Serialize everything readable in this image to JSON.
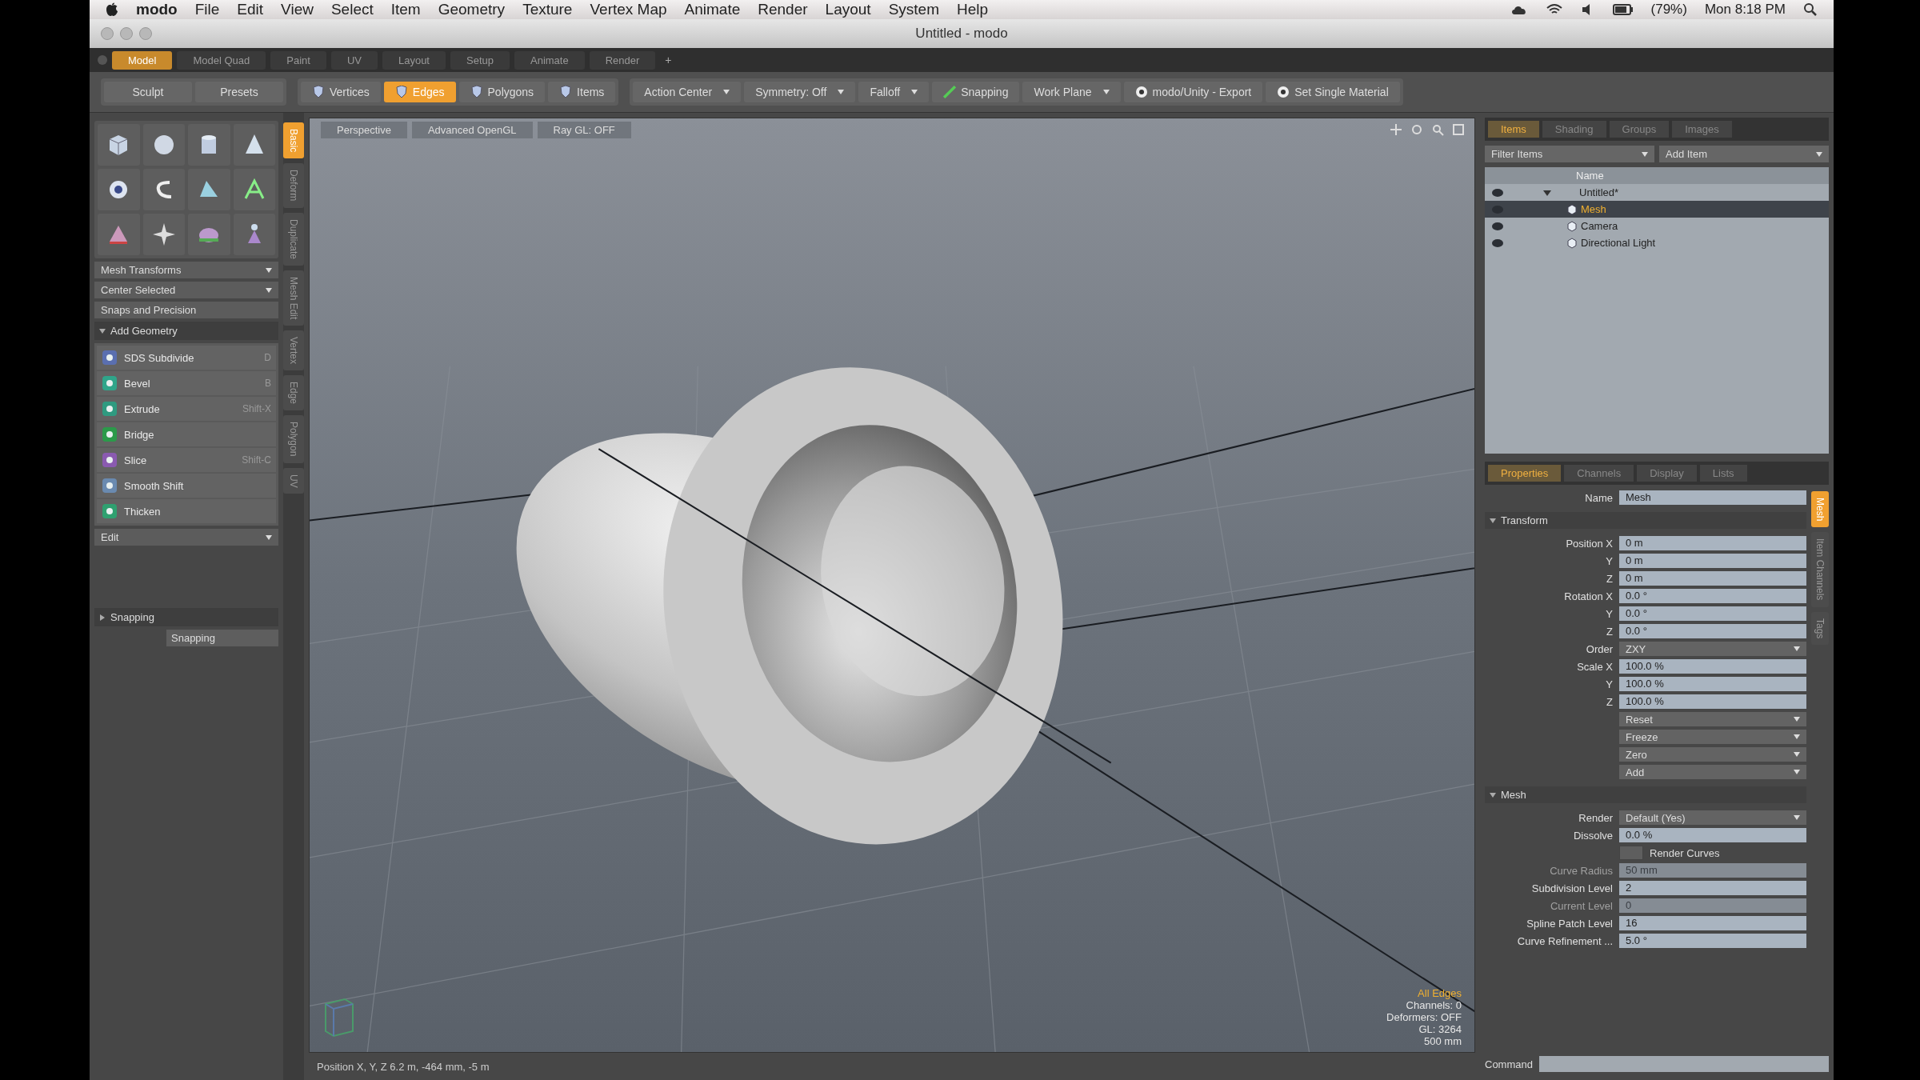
{
  "menubar": {
    "app": "modo",
    "items": [
      "File",
      "Edit",
      "View",
      "Select",
      "Item",
      "Geometry",
      "Texture",
      "Vertex Map",
      "Animate",
      "Render",
      "Layout",
      "System",
      "Help"
    ],
    "battery": "(79%)",
    "clock": "Mon 8:18 PM"
  },
  "window": {
    "title": "Untitled - modo"
  },
  "layout_tabs": [
    {
      "label": "Model",
      "selected": true
    },
    {
      "label": "Model Quad",
      "selected": false
    },
    {
      "label": "Paint",
      "selected": false
    },
    {
      "label": "UV",
      "selected": false
    },
    {
      "label": "Layout",
      "selected": false
    },
    {
      "label": "Setup",
      "selected": false
    },
    {
      "label": "Animate",
      "selected": false
    },
    {
      "label": "Render",
      "selected": false
    }
  ],
  "add_tab": "+",
  "toolbar": {
    "left_buttons": [
      "Sculpt",
      "Presets"
    ],
    "modes": [
      {
        "label": "Vertices",
        "selected": false
      },
      {
        "label": "Edges",
        "selected": true
      },
      {
        "label": "Polygons",
        "selected": false
      },
      {
        "label": "Items",
        "selected": false
      }
    ],
    "dropdowns": [
      "Action Center",
      "Symmetry: Off",
      "Falloff"
    ],
    "snapping": "Snapping",
    "work_plane": "Work Plane",
    "actions": [
      "modo/Unity - Export",
      "Set Single Material"
    ]
  },
  "toolbox": {
    "dropdowns": [
      "Mesh Transforms",
      "Center Selected"
    ],
    "snaps": "Snaps and Precision",
    "section": "Add Geometry",
    "tools": [
      {
        "label": "SDS Subdivide",
        "shortcut": "D"
      },
      {
        "label": "Bevel",
        "shortcut": "B"
      },
      {
        "label": "Extrude",
        "shortcut": "Shift-X"
      },
      {
        "label": "Bridge"
      },
      {
        "label": "Slice",
        "shortcut": "Shift-C"
      },
      {
        "label": "Smooth Shift"
      },
      {
        "label": "Thicken"
      }
    ],
    "edit": "Edit",
    "snapping_section": "Snapping",
    "snapping_button": "Snapping"
  },
  "side_tabs": [
    {
      "label": "Basic",
      "selected": true
    },
    {
      "label": "Deform",
      "selected": false
    },
    {
      "label": "Duplicate",
      "selected": false
    },
    {
      "label": "Mesh Edit",
      "selected": false
    },
    {
      "label": "Vertex",
      "selected": false
    },
    {
      "label": "Edge",
      "selected": false
    },
    {
      "label": "Polygon",
      "selected": false
    },
    {
      "label": "UV",
      "selected": false
    }
  ],
  "viewport": {
    "tabs": [
      "Perspective",
      "Advanced OpenGL",
      "Ray GL: OFF"
    ],
    "info": [
      "All Edges",
      "Channels: 0",
      "Deformers: OFF",
      "GL: 3264",
      "500 mm"
    ],
    "status": "Position X, Y, Z   6.2 m, -464 mm, -5 m"
  },
  "outliner": {
    "tabs": [
      {
        "label": "Items",
        "selected": true
      },
      {
        "label": "Shading",
        "selected": false
      },
      {
        "label": "Groups",
        "selected": false
      },
      {
        "label": "Images",
        "selected": false
      }
    ],
    "filter": "Filter Items",
    "add": "Add Item",
    "header": "Name",
    "tree": [
      {
        "label": "Untitled*",
        "expanded": true,
        "selected": false,
        "children": [
          {
            "label": "Mesh",
            "selected": true
          },
          {
            "label": "Camera",
            "selected": false
          },
          {
            "label": "Directional Light",
            "selected": false
          }
        ]
      }
    ]
  },
  "properties": {
    "tabs": [
      {
        "label": "Properties",
        "selected": true
      },
      {
        "label": "Channels",
        "selected": false
      },
      {
        "label": "Display",
        "selected": false
      },
      {
        "label": "Lists",
        "selected": false
      }
    ],
    "side_tabs": [
      {
        "label": "Mesh",
        "selected": true
      },
      {
        "label": "Item Channels",
        "selected": false
      },
      {
        "label": "Tags",
        "selected": false
      }
    ],
    "rows": [
      {
        "kind": "field",
        "label": "Name",
        "value": "Mesh",
        "disabled": false
      },
      {
        "kind": "section",
        "label": "Transform"
      },
      {
        "kind": "field",
        "label": "Position X",
        "value": "0 m",
        "disabled": false
      },
      {
        "kind": "field",
        "label": "Y",
        "value": "0 m",
        "disabled": false
      },
      {
        "kind": "field",
        "label": "Z",
        "value": "0 m",
        "disabled": false
      },
      {
        "kind": "field",
        "label": "Rotation X",
        "value": "0.0 °",
        "disabled": false
      },
      {
        "kind": "field",
        "label": "Y",
        "value": "0.0 °",
        "disabled": false
      },
      {
        "kind": "field",
        "label": "Z",
        "value": "0.0 °",
        "disabled": false
      },
      {
        "kind": "dropdown",
        "label": "Order",
        "value": "ZXY"
      },
      {
        "kind": "field",
        "label": "Scale X",
        "value": "100.0 %",
        "disabled": false
      },
      {
        "kind": "field",
        "label": "Y",
        "value": "100.0 %",
        "disabled": false
      },
      {
        "kind": "field",
        "label": "Z",
        "value": "100.0 %",
        "disabled": false
      },
      {
        "kind": "dropdown",
        "value": "Reset"
      },
      {
        "kind": "dropdown",
        "value": "Freeze"
      },
      {
        "kind": "dropdown",
        "value": "Zero"
      },
      {
        "kind": "dropdown",
        "value": "Add"
      },
      {
        "kind": "section",
        "label": "Mesh"
      },
      {
        "kind": "dropdown",
        "label": "Render",
        "value": "Default (Yes)"
      },
      {
        "kind": "field",
        "label": "Dissolve",
        "value": "0.0 %",
        "disabled": false
      },
      {
        "kind": "checkbox",
        "label": "Render Curves",
        "checked": false
      },
      {
        "kind": "field",
        "label": "Curve Radius",
        "value": "50 mm",
        "disabled": true
      },
      {
        "kind": "field",
        "label": "Subdivision Level",
        "value": "2",
        "disabled": false
      },
      {
        "kind": "field",
        "label": "Current Level",
        "value": "0",
        "disabled": true
      },
      {
        "kind": "field",
        "label": "Spline Patch Level",
        "value": "16",
        "disabled": false
      },
      {
        "kind": "field",
        "label": "Curve Refinement ...",
        "value": "5.0 °",
        "disabled": false
      }
    ]
  },
  "command": {
    "label": "Command"
  }
}
